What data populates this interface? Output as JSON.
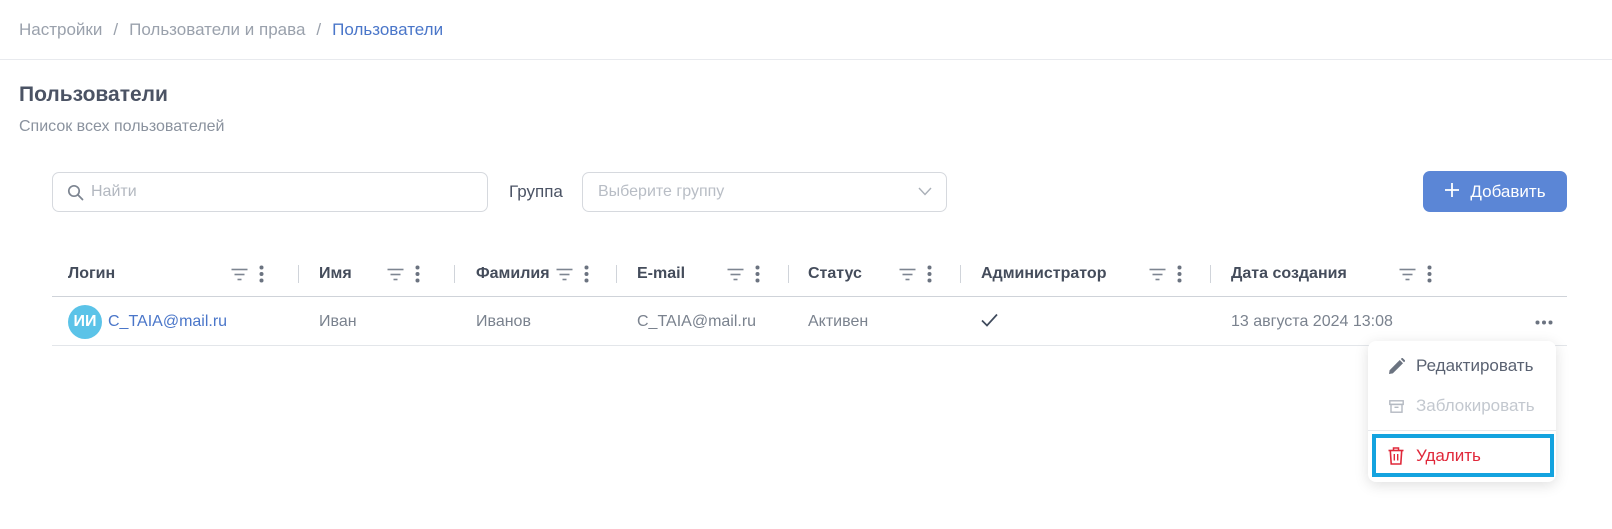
{
  "breadcrumb": {
    "items": [
      "Настройки",
      "Пользователи и права"
    ],
    "separator": "/",
    "current": "Пользователи"
  },
  "page": {
    "title": "Пользователи",
    "subtitle": "Список всех пользователей"
  },
  "toolbar": {
    "search_placeholder": "Найти",
    "group_label": "Группа",
    "group_placeholder": "Выберите группу",
    "add_button": "Добавить"
  },
  "table": {
    "columns": [
      "Логин",
      "Имя",
      "Фамилия",
      "E-mail",
      "Статус",
      "Администратор",
      "Дата создания"
    ],
    "rows": [
      {
        "avatar_initials": "ИИ",
        "login": "C_TAIA@mail.ru",
        "first_name": "Иван",
        "last_name": "Иванов",
        "email": "C_TAIA@mail.ru",
        "status": "Активен",
        "admin": "✓",
        "created": "13 августа 2024 13:08"
      }
    ]
  },
  "context_menu": {
    "edit": "Редактировать",
    "block": "Заблокировать",
    "delete": "Удалить"
  },
  "icons": {
    "search": "search-icon",
    "chevron": "chevron-down-icon",
    "plus": "plus-icon",
    "filter": "filter-icon",
    "column_menu": "more-vertical-icon",
    "row_menu": "more-horizontal-icon",
    "edit": "pencil-icon",
    "block": "archive-icon",
    "delete": "trash-icon"
  },
  "colors": {
    "accent": "#5b86d6",
    "link": "#4a76c9",
    "danger": "#e0283a",
    "avatar": "#5bc3e8",
    "highlight": "#14a3df"
  }
}
